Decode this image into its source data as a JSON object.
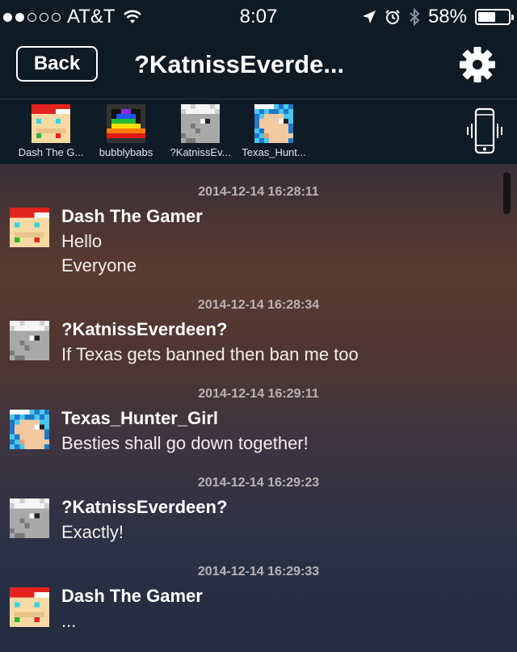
{
  "status": {
    "carrier": "AT&T",
    "signal_filled": 2,
    "signal_total": 5,
    "time": "8:07",
    "battery": "58%",
    "battery_level": 0.58
  },
  "nav": {
    "back_label": "Back",
    "title": "?KatnissEverde..."
  },
  "members": [
    {
      "name": "Dash The G...",
      "avatar": "dash-avatar"
    },
    {
      "name": "bubblybabs",
      "avatar": "bubbly-avatar"
    },
    {
      "name": "?KatnissEv...",
      "avatar": "katniss-avatar"
    },
    {
      "name": "Texas_Hunt...",
      "avatar": "texas-avatar"
    }
  ],
  "messages": [
    {
      "timestamp": "2014-12-14 16:28:11",
      "sender": "Dash The Gamer",
      "avatar": "dash-avatar",
      "lines": [
        "Hello",
        "Everyone"
      ]
    },
    {
      "timestamp": "2014-12-14 16:28:34",
      "sender": "?KatnissEverdeen?",
      "avatar": "katniss-avatar",
      "lines": [
        "If Texas gets banned then ban me too"
      ]
    },
    {
      "timestamp": "2014-12-14 16:29:11",
      "sender": "Texas_Hunter_Girl",
      "avatar": "texas-avatar",
      "lines": [
        "Besties shall go down together!"
      ]
    },
    {
      "timestamp": "2014-12-14 16:29:23",
      "sender": "?KatnissEverdeen?",
      "avatar": "katniss-avatar",
      "lines": [
        "Exactly!"
      ]
    },
    {
      "timestamp": "2014-12-14 16:29:33",
      "sender": "Dash The Gamer",
      "avatar": "dash-avatar",
      "lines": [
        "..."
      ]
    }
  ]
}
